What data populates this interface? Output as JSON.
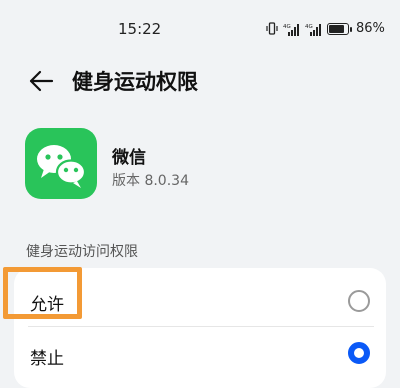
{
  "status_bar": {
    "time": "15:22",
    "battery": "86%",
    "battery_level": 0.86,
    "icons": [
      "vibrate-icon",
      "signal-4g-icon",
      "signal-4g-icon",
      "battery-icon"
    ],
    "network_label": "4G"
  },
  "header": {
    "title": "健身运动权限",
    "back_icon": "back-arrow-icon"
  },
  "app": {
    "name": "微信",
    "version": "版本 8.0.34",
    "icon": "wechat-logo-icon",
    "icon_color": "#29c45a"
  },
  "section": {
    "label": "健身运动访问权限"
  },
  "options": [
    {
      "label": "允许",
      "selected": false
    },
    {
      "label": "禁止",
      "selected": true
    }
  ],
  "colors": {
    "accent": "#0a59f7",
    "highlight": "#f39a35"
  }
}
